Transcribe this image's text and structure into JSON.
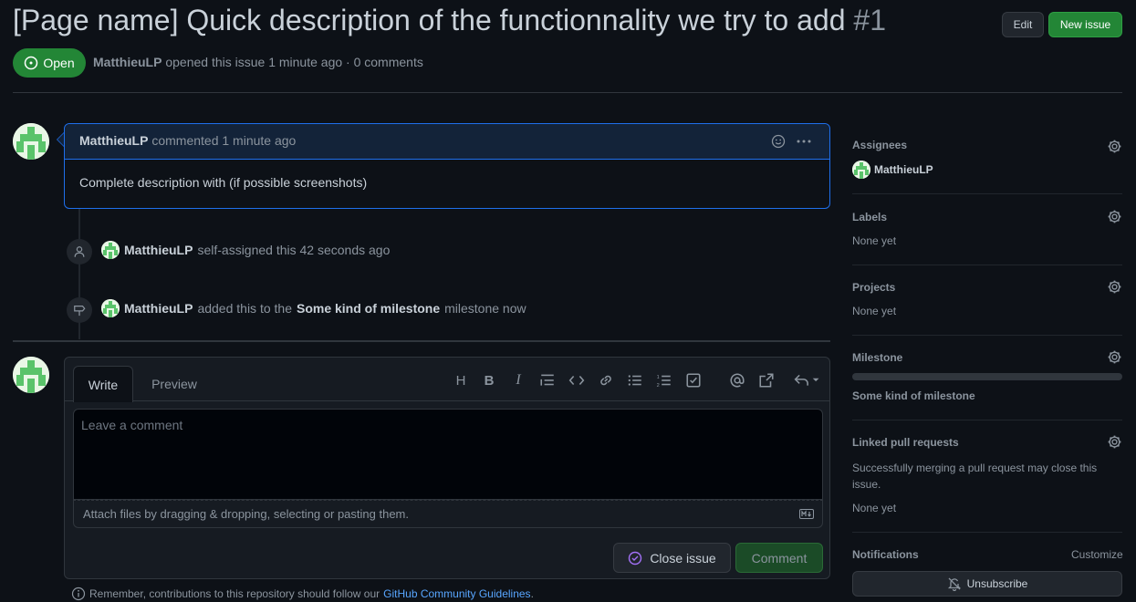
{
  "issue": {
    "title": "[Page name] Quick description of the functionnality we try to add",
    "number": "#1",
    "state": "Open",
    "author": "MatthieuLP",
    "opened_text": "opened this issue 1 minute ago · 0 comments",
    "edit_label": "Edit",
    "new_issue_label": "New issue"
  },
  "comment": {
    "author": "MatthieuLP",
    "time": "commented 1 minute ago",
    "body": "Complete description with (if possible screenshots)"
  },
  "timeline": [
    {
      "actor": "MatthieuLP",
      "text": "self-assigned this 42 seconds ago"
    },
    {
      "actor": "MatthieuLP",
      "pre": "added this to the",
      "milestone": "Some kind of milestone",
      "post": "milestone now"
    }
  ],
  "editor": {
    "tab_write": "Write",
    "tab_preview": "Preview",
    "placeholder": "Leave a comment",
    "attach_hint": "Attach files by dragging & dropping, selecting or pasting them.",
    "close_label": "Close issue",
    "comment_label": "Comment",
    "toolbar": [
      "H",
      "B",
      "I"
    ]
  },
  "footer": {
    "remember_text": "Remember, contributions to this repository should follow our",
    "link_text": "GitHub Community Guidelines",
    "end": "."
  },
  "sidebar": {
    "assignees": {
      "heading": "Assignees",
      "user": "MatthieuLP"
    },
    "labels": {
      "heading": "Labels",
      "value": "None yet"
    },
    "projects": {
      "heading": "Projects",
      "value": "None yet"
    },
    "milestone": {
      "heading": "Milestone",
      "value": "Some kind of milestone",
      "progress": 0
    },
    "linked_prs": {
      "heading": "Linked pull requests",
      "description": "Successfully merging a pull request may close this issue.",
      "value": "None yet"
    },
    "notifications": {
      "heading": "Notifications",
      "customize": "Customize",
      "unsubscribe": "Unsubscribe"
    }
  },
  "colors": {
    "accent_green": "#238636",
    "link_blue": "#58a6ff",
    "bg": "#0d1117",
    "comment_border": "#1f6feb"
  }
}
